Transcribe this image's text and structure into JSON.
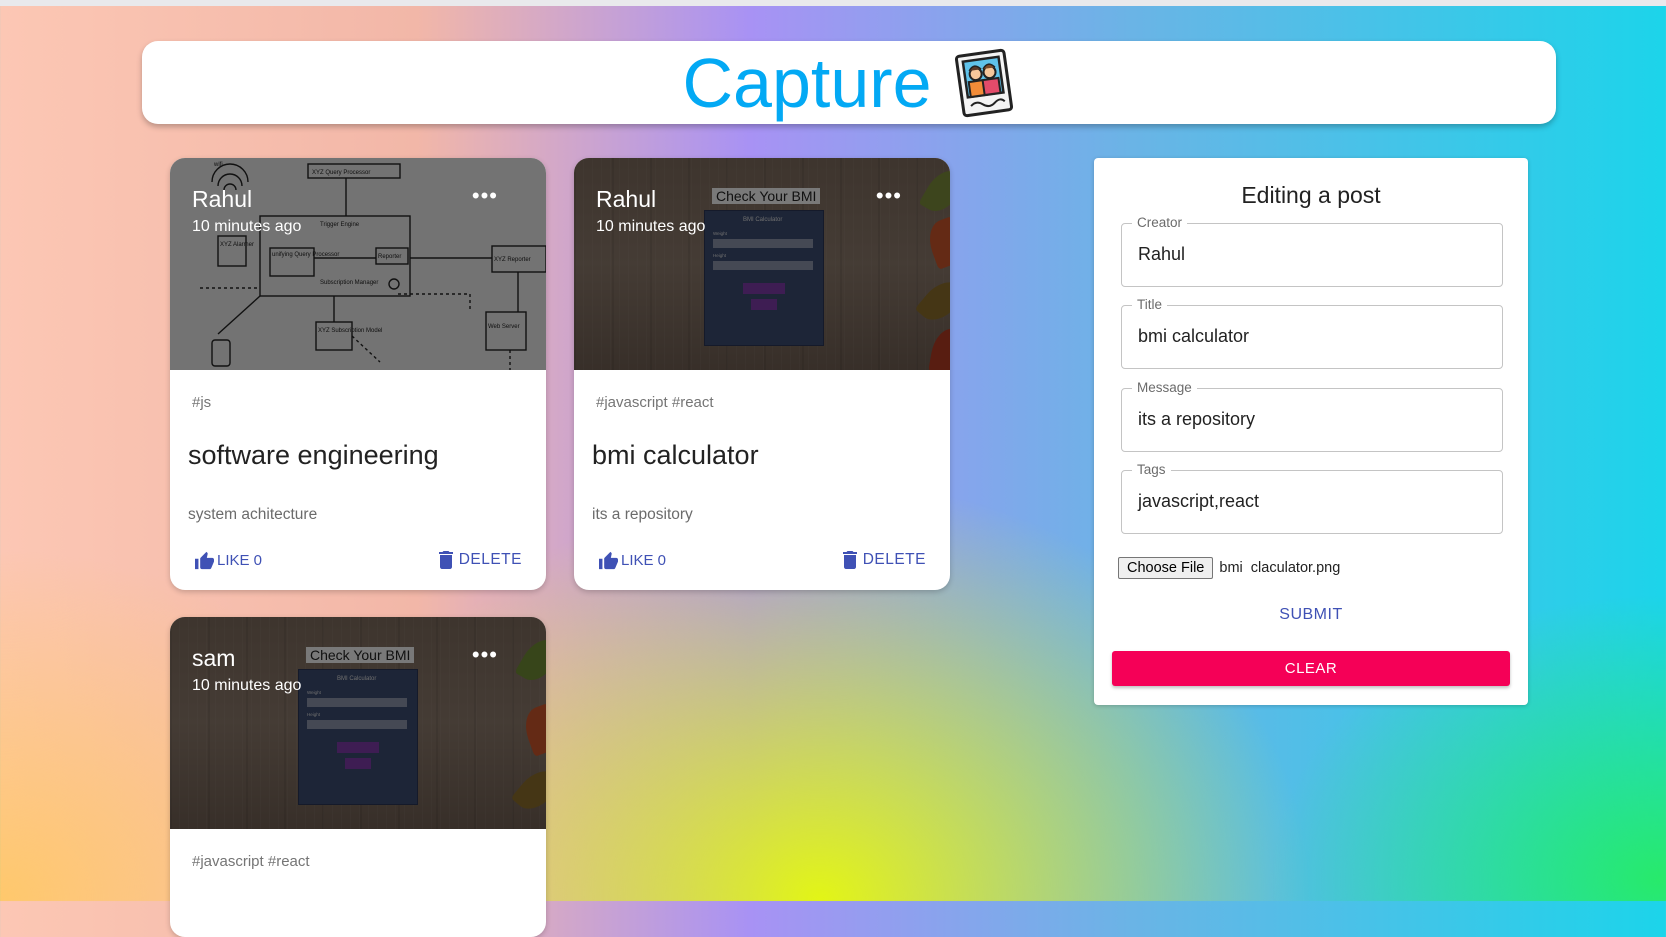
{
  "app": {
    "title": "Capture",
    "logo": "photo-polaroid-logo"
  },
  "posts": [
    {
      "creator": "Rahul",
      "time": "10 minutes ago",
      "more": "•••",
      "tags": "#js",
      "title": "software engineering",
      "message": "system achitecture",
      "like_label": "LIKE 0",
      "delete_label": "DELETE",
      "image": {
        "type": "architecture-diagram",
        "labels": {
          "wifi": "wifi",
          "xyz_query_processor": "XYZ Query Processor",
          "trigger_engine": "Trigger Engine",
          "xyz_alarmer": "XYZ Alarmer",
          "unifying_query_processor": "unifying Query Processor",
          "reporter": "Reporter",
          "subscription_manager": "Subscription Manager",
          "xyz_reporter": "XYZ Reporter",
          "xyz_subscription_model": "XYZ Subscription Model",
          "web_server": "Web Server"
        }
      }
    },
    {
      "creator": "Rahul",
      "time": "10 minutes ago",
      "more": "•••",
      "tags": "#javascript #react",
      "title": "bmi calculator",
      "message": "its a repository",
      "like_label": "LIKE 0",
      "delete_label": "DELETE",
      "image": {
        "type": "bmi-screenshot",
        "heading": "Check Your BMI",
        "panel_title": "BMI Calculator",
        "weight_label": "Weight",
        "height_label": "Height",
        "calc_button": "Calculate BMI",
        "reload_button": "Reload"
      }
    },
    {
      "creator": "sam",
      "time": "10 minutes ago",
      "more": "•••",
      "tags": "#javascript #react",
      "image": {
        "type": "bmi-screenshot",
        "heading": "Check Your BMI",
        "panel_title": "BMI Calculator",
        "weight_label": "Weight",
        "height_label": "Height",
        "calc_button": "Calculate BMI",
        "reload_button": "Reload"
      }
    }
  ],
  "form": {
    "heading": "Editing a post",
    "fields": [
      {
        "label": "Creator",
        "value": "Rahul"
      },
      {
        "label": "Title",
        "value": "bmi calculator"
      },
      {
        "label": "Message",
        "value": "its a repository"
      },
      {
        "label": "Tags",
        "value": "javascript,react"
      }
    ],
    "choose_file_label": "Choose File",
    "file_name": "bmi  claculator.png",
    "submit_label": "SUBMIT",
    "clear_label": "CLEAR"
  },
  "colors": {
    "brand": "#03a9f4",
    "primary": "#3f51b5",
    "secondary": "#f50057"
  }
}
